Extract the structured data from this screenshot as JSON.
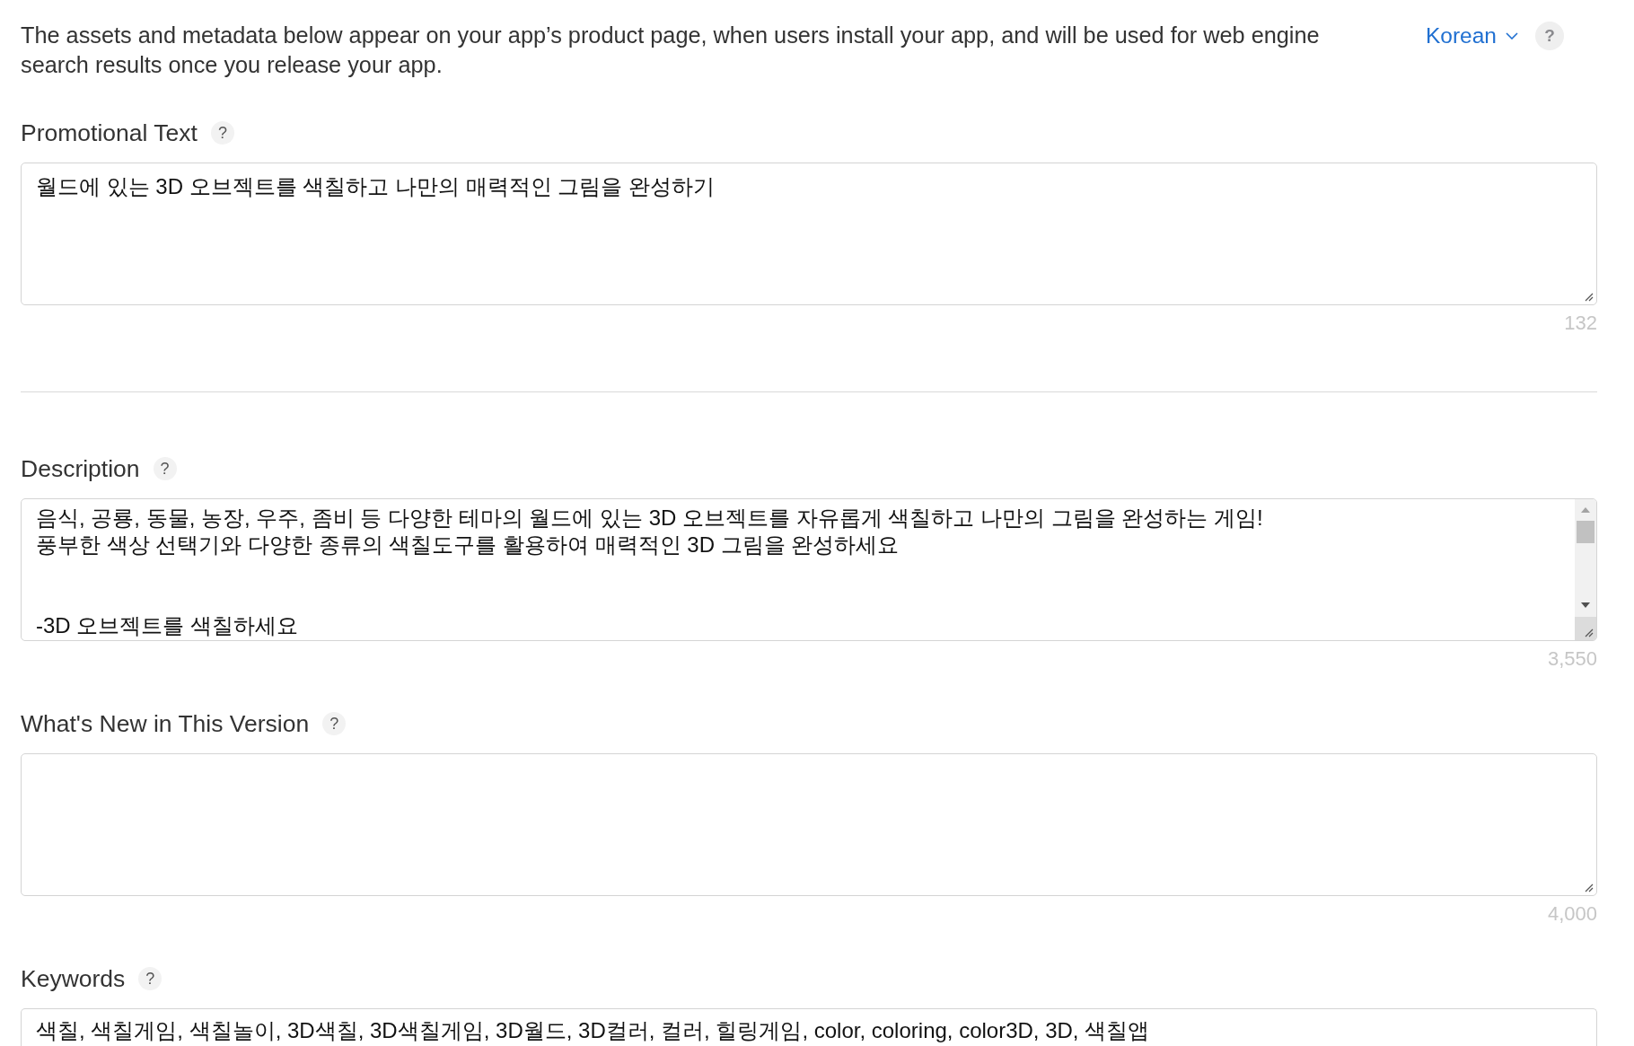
{
  "intro": {
    "text": "The assets and metadata below appear on your app’s product page, when users install your app, and will be used for web engine search results once you release your app.",
    "language": "Korean",
    "help": "?"
  },
  "fields": [
    {
      "kind": "textarea",
      "label": "Promotional Text",
      "help": "?",
      "value": "월드에 있는 3D 오브젝트를 색칠하고 나만의 매력적인 그림을 완성하기",
      "count": "132",
      "scrollbar": false,
      "divider_after": true
    },
    {
      "kind": "textarea",
      "label": "Description",
      "help": "?",
      "value": "음식, 공룡, 동물, 농장, 우주, 좀비 등 다양한 테마의 월드에 있는 3D 오브젝트를 자유롭게 색칠하고 나만의 그림을 완성하는 게임!\n풍부한 색상 선택기와 다양한 종류의 색칠도구를 활용하여 매력적인 3D 그림을 완성하세요\n\n\n-3D 오브젝트를 색칠하세요",
      "count": "3,550",
      "scrollbar": true,
      "divider_after": false
    },
    {
      "kind": "textarea",
      "label": "What's New in This Version",
      "help": "?",
      "count": "4,000",
      "scrollbar": false,
      "divider_after": false
    },
    {
      "kind": "input",
      "label": "Keywords",
      "help": "?",
      "value": "색칠, 색칠게임, 색칠놀이, 3D색칠, 3D색칠게임, 3D월드, 3D컬러, 컬러, 힐링게임, color, coloring, color3D, 3D, 색칠앱",
      "scrollbar": false,
      "divider_after": false
    }
  ]
}
